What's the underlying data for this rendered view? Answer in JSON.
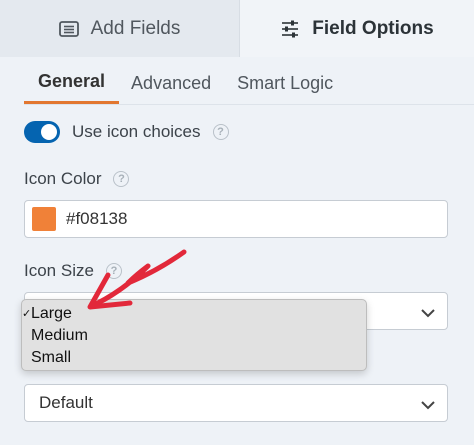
{
  "top_tabs": [
    {
      "label": "Add Fields",
      "icon": "list-icon",
      "active": false
    },
    {
      "label": "Field Options",
      "icon": "sliders-icon",
      "active": true
    }
  ],
  "sub_tabs": [
    {
      "label": "General",
      "active": true
    },
    {
      "label": "Advanced",
      "active": false
    },
    {
      "label": "Smart Logic",
      "active": false
    }
  ],
  "toggle": {
    "label": "Use icon choices",
    "on": true,
    "help": "?"
  },
  "icon_color": {
    "label": "Icon Color",
    "help": "?",
    "value": "#f08138",
    "swatch": "#f08138"
  },
  "icon_size": {
    "label": "Icon Size",
    "help": "?",
    "options": [
      "Large",
      "Medium",
      "Small"
    ],
    "selected": "Large",
    "check": "✓"
  },
  "style_select": {
    "value": "Default"
  },
  "colors": {
    "accent": "#e27730",
    "toggle": "#0564b0",
    "annotation": "#e2283a"
  }
}
